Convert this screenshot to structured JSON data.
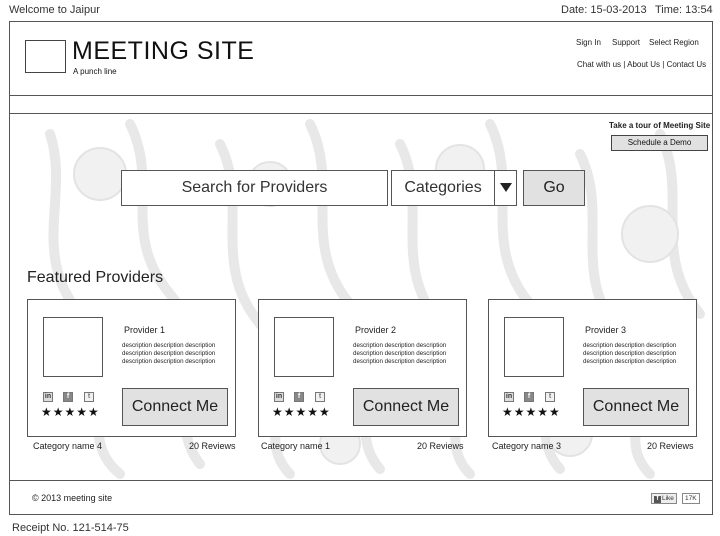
{
  "topbar": {
    "welcome": "Welcome to Jaipur",
    "date": "Date: 15-03-2013",
    "time": "Time: 13:54"
  },
  "header": {
    "site_title": "MEETING SITE",
    "tagline": "A punch line",
    "links": [
      "Sign In",
      "Support",
      "Select Region"
    ],
    "sublinks": [
      "Chat with us",
      "About Us",
      "Contact Us"
    ],
    "separator": " | "
  },
  "tour": {
    "text": "Take a tour of Meeting Site",
    "button": "Schedule a Demo"
  },
  "search": {
    "placeholder": "Search for Providers",
    "category_label": "Categories",
    "go_label": "Go"
  },
  "featured": {
    "title": "Featured Providers",
    "providers": [
      {
        "name": "Provider 1",
        "description": "description description description description description description description description description",
        "connect": "Connect Me",
        "rating": "★★★★★",
        "category": "Category name 4",
        "reviews": "20 Reviews"
      },
      {
        "name": "Provider 2",
        "description": "description description description description description description description description description",
        "connect": "Connect Me",
        "rating": "★★★★★",
        "category": "Category name 1",
        "reviews": "20 Reviews"
      },
      {
        "name": "Provider 3",
        "description": "description description description description description description description description description",
        "connect": "Connect Me",
        "rating": "★★★★★",
        "category": "Category name 3",
        "reviews": "20 Reviews"
      }
    ]
  },
  "icons": {
    "linkedin": "in",
    "facebook": "f",
    "twitter": "t"
  },
  "footer": {
    "copyright": "© 2013 meeting site",
    "like": "Like",
    "like_count": "17K"
  },
  "receipt": "Receipt No. 121-514-75"
}
